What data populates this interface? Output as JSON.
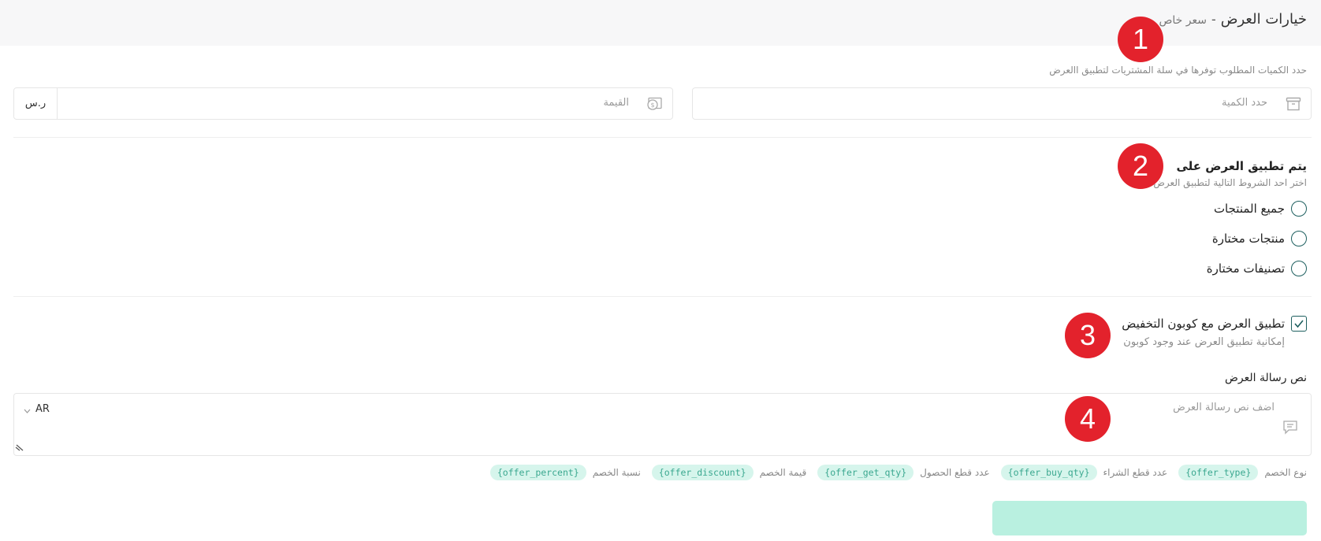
{
  "header": {
    "title": "خيارات العرض",
    "separator": "-",
    "subtitle": "سعر خاص"
  },
  "quantity_section": {
    "hint": "حدد الكميات المطلوب توفرها في سلة المشتريات لتطبيق االعرض",
    "quantity_placeholder": "حدد الكمية",
    "value_placeholder": "القيمة",
    "currency": "ر.س"
  },
  "apply_section": {
    "title": "يتم تطبيق العرض على",
    "hint": "اختر احد الشروط التالية لتطبيق العرض",
    "options": [
      {
        "label": "جميع المنتجات"
      },
      {
        "label": "منتجات مختارة"
      },
      {
        "label": "تصنيفات مختارة"
      }
    ]
  },
  "coupon_section": {
    "checked": true,
    "label": "تطبيق العرض مع كوبون التخفيض",
    "hint": "إمكانية تطبيق العرض عند وجود كوبون"
  },
  "message_section": {
    "label": "نص رسالة العرض",
    "placeholder": "اضف نص رسالة العرض",
    "language": "AR"
  },
  "variables": [
    {
      "label": "نوع الخصم",
      "token": "{offer_type}"
    },
    {
      "label": "عدد قطع الشراء",
      "token": "{offer_buy_qty}"
    },
    {
      "label": "عدد قطع الحصول",
      "token": "{offer_get_qty}"
    },
    {
      "label": "قيمة الخصم",
      "token": "{offer_discount}"
    },
    {
      "label": "نسبة الخصم",
      "token": "{offer_percent}"
    }
  ],
  "markers": [
    "1",
    "2",
    "3",
    "4"
  ],
  "colors": {
    "accent": "#1e5f5f",
    "marker": "#e3222c",
    "chip_bg": "#d6f5ec",
    "chip_text": "#3ba890",
    "save_button": "#b9f0e0"
  },
  "icons": [
    "box-icon",
    "money-icon",
    "chevron-down-icon",
    "message-icon",
    "checkmark-icon",
    "resize-handle-icon"
  ]
}
